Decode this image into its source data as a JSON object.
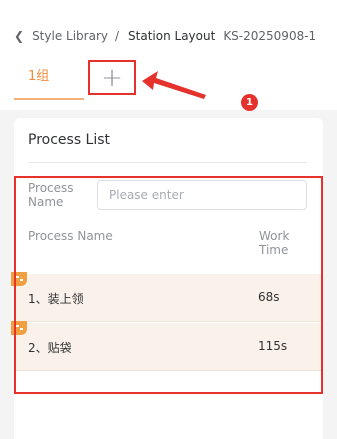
{
  "breadcrumb": {
    "back_icon": "chevron-left-icon",
    "parent": "Style Library",
    "separator": "/",
    "current": "Station Layout",
    "code": "KS-20250908-1"
  },
  "tabs": [
    {
      "label": "1组",
      "active": true
    }
  ],
  "add_tab": {
    "icon": "plus-icon"
  },
  "annotation": {
    "badge": "1",
    "color": "#e5322d"
  },
  "panel": {
    "title": "Process List",
    "filter": {
      "label": "Process Name",
      "placeholder": "Please enter",
      "value": ""
    },
    "columns": {
      "name": "Process Name",
      "time": "Work Time"
    },
    "rows": [
      {
        "name": "1、装上领",
        "time": "68s"
      },
      {
        "name": "2、贴袋",
        "time": "115s"
      }
    ]
  },
  "colors": {
    "accent": "#f08c3c",
    "highlight": "#e5322d",
    "row_bg": "#faf2ea",
    "corner_badge": "#f0a040"
  }
}
